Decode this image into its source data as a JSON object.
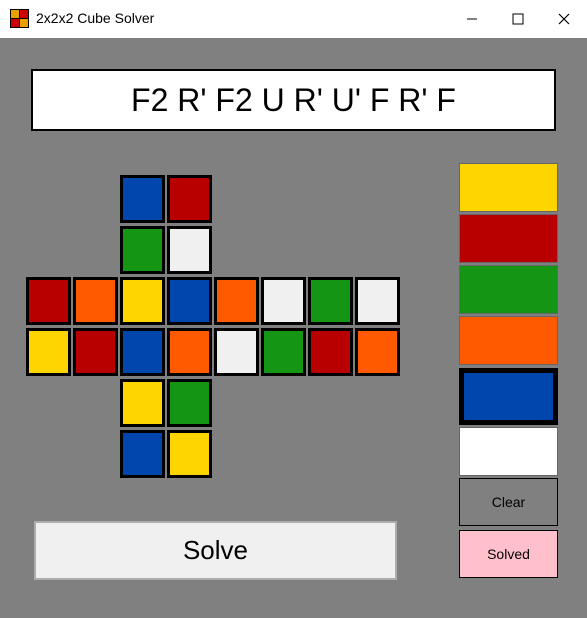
{
  "window": {
    "title": "2x2x2 Cube Solver",
    "icon": "cube-icon",
    "icon_colors": [
      "#e8a000",
      "#cc0000",
      "#cc0000",
      "#e8a000"
    ],
    "controls": [
      "minimize-icon",
      "maximize-icon",
      "close-icon"
    ]
  },
  "solution": {
    "text": "F2 R' F2 U R' U' F R' F"
  },
  "colors": {
    "Y": "#ffd500",
    "R": "#b80000",
    "G": "#149614",
    "O": "#ff5a00",
    "B": "#0046ad",
    "W": "#f0f0f0"
  },
  "net": {
    "up": [
      [
        "B",
        "R"
      ],
      [
        "G",
        "W"
      ]
    ],
    "left": [
      [
        "R",
        "O"
      ],
      [
        "Y",
        "R"
      ]
    ],
    "front": [
      [
        "Y",
        "B"
      ],
      [
        "B",
        "O"
      ]
    ],
    "right": [
      [
        "O",
        "W"
      ],
      [
        "W",
        "G"
      ]
    ],
    "back": [
      [
        "G",
        "W"
      ],
      [
        "R",
        "O"
      ]
    ],
    "down": [
      [
        "Y",
        "G"
      ],
      [
        "B",
        "Y"
      ]
    ]
  },
  "palette": {
    "swatches": [
      {
        "name": "yellow",
        "color": "#ffd500",
        "selected": false
      },
      {
        "name": "red",
        "color": "#b80000",
        "selected": false
      },
      {
        "name": "green",
        "color": "#149614",
        "selected": false
      },
      {
        "name": "orange",
        "color": "#ff5a00",
        "selected": false
      },
      {
        "name": "blue",
        "color": "#0046ad",
        "selected": true
      },
      {
        "name": "white",
        "color": "#ffffff",
        "selected": false
      }
    ],
    "clear_label": "Clear",
    "clear_color": "#808080",
    "solved_label": "Solved",
    "solved_color": "#ffc0cb"
  },
  "solve_label": "Solve"
}
